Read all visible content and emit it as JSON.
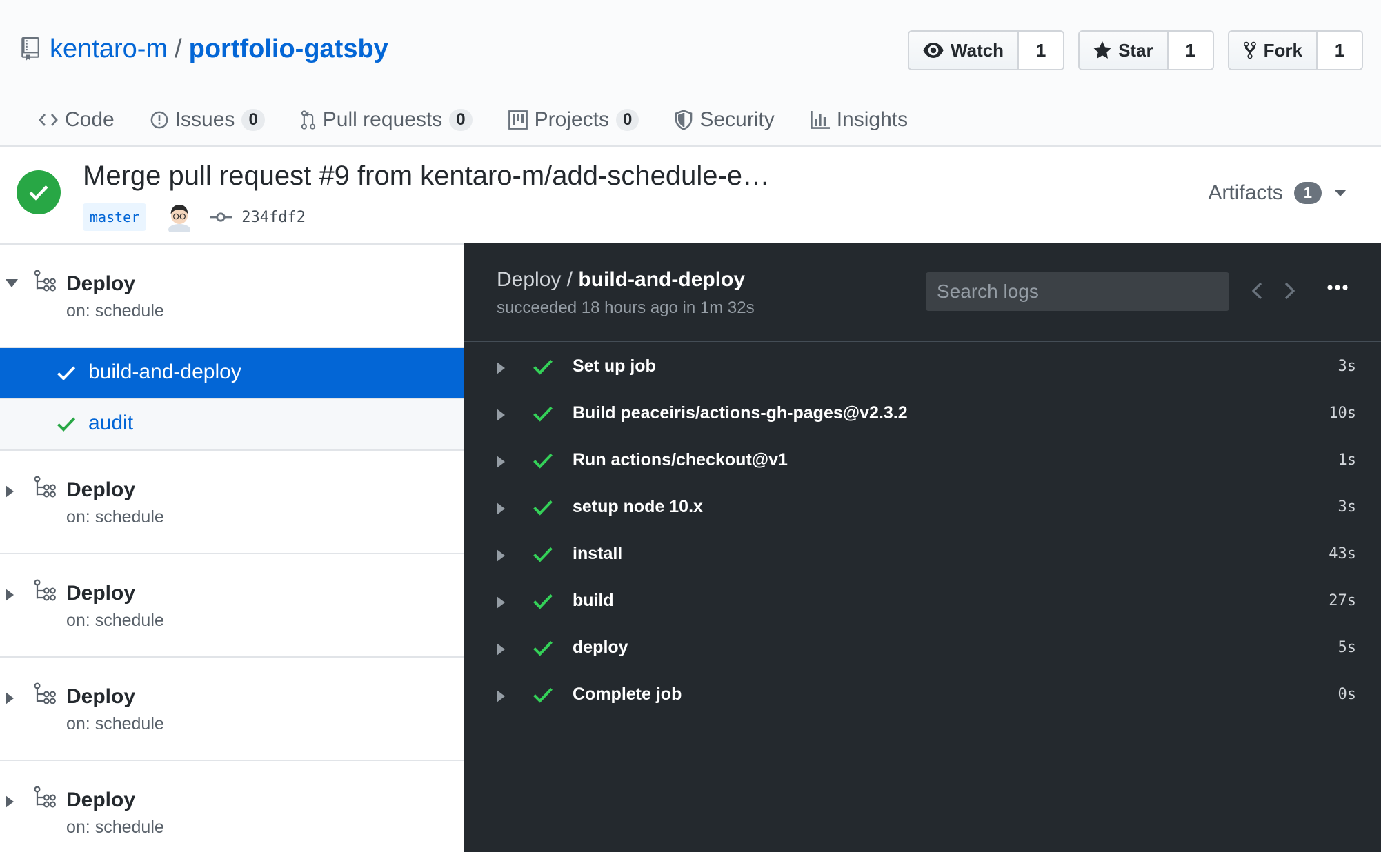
{
  "repo": {
    "owner": "kentaro-m",
    "separator": "/",
    "name": "portfolio-gatsby"
  },
  "actions": [
    {
      "label": "Watch",
      "count": "1",
      "icon": "eye-icon"
    },
    {
      "label": "Star",
      "count": "1",
      "icon": "star-icon"
    },
    {
      "label": "Fork",
      "count": "1",
      "icon": "fork-icon"
    }
  ],
  "nav": [
    {
      "label": "Code",
      "icon": "code-icon"
    },
    {
      "label": "Issues",
      "counter": "0",
      "icon": "issue-icon"
    },
    {
      "label": "Pull requests",
      "counter": "0",
      "icon": "pull-request-icon"
    },
    {
      "label": "Projects",
      "counter": "0",
      "icon": "project-icon"
    },
    {
      "label": "Security",
      "icon": "shield-icon"
    },
    {
      "label": "Insights",
      "icon": "graph-icon"
    }
  ],
  "run": {
    "title": "Merge pull request #9 from kentaro-m/add-schedule-e…",
    "branch": "master",
    "sha": "234fdf2",
    "artifacts_label": "Artifacts",
    "artifacts_count": "1",
    "status_color": "#28a745"
  },
  "workflows": [
    {
      "name": "Deploy",
      "trigger": "on: schedule",
      "expanded": true,
      "jobs": [
        {
          "name": "build-and-deploy",
          "active": true
        },
        {
          "name": "audit",
          "active": false
        }
      ]
    },
    {
      "name": "Deploy",
      "trigger": "on: schedule",
      "expanded": false
    },
    {
      "name": "Deploy",
      "trigger": "on: schedule",
      "expanded": false
    },
    {
      "name": "Deploy",
      "trigger": "on: schedule",
      "expanded": false
    },
    {
      "name": "Deploy",
      "trigger": "on: schedule",
      "expanded": false
    }
  ],
  "log": {
    "workflow": "Deploy",
    "separator": " / ",
    "job": "build-and-deploy",
    "summary": "succeeded 18 hours ago in 1m 32s",
    "search_placeholder": "Search logs",
    "steps": [
      {
        "name": "Set up job",
        "duration": "3s"
      },
      {
        "name": "Build peaceiris/actions-gh-pages@v2.3.2",
        "duration": "10s"
      },
      {
        "name": "Run actions/checkout@v1",
        "duration": "1s"
      },
      {
        "name": "setup node 10.x",
        "duration": "3s"
      },
      {
        "name": "install",
        "duration": "43s"
      },
      {
        "name": "build",
        "duration": "27s"
      },
      {
        "name": "deploy",
        "duration": "5s"
      },
      {
        "name": "Complete job",
        "duration": "0s"
      }
    ]
  },
  "colors": {
    "link": "#0366d6",
    "success": "#28a745",
    "log_bg": "#24292e"
  }
}
